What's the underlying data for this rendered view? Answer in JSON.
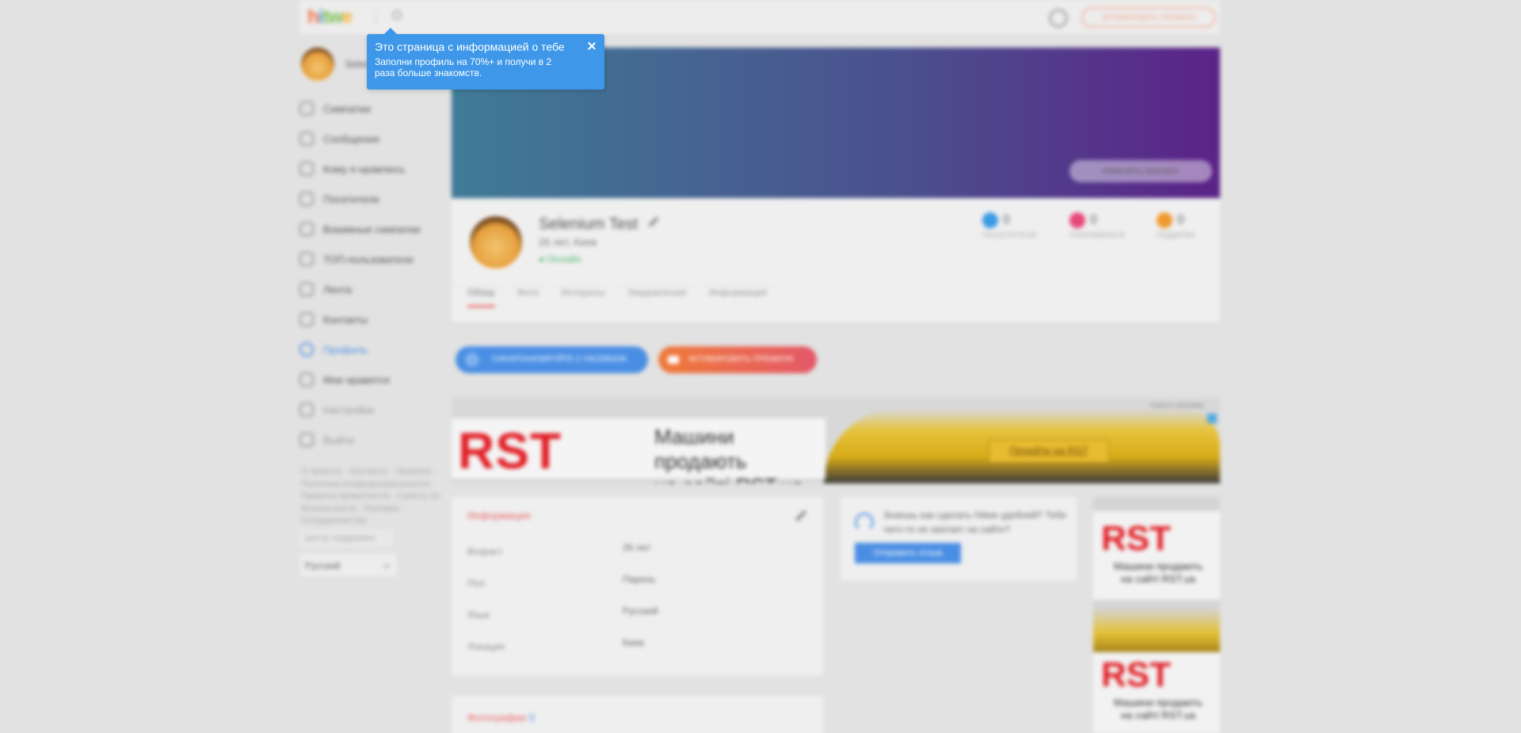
{
  "topbar": {
    "logo": {
      "h": "h",
      "i": "i",
      "t": "tw",
      "e": "oo"
    },
    "premium_label": "АКТИВИРОВАТЬ ПРЕМИУМ"
  },
  "sidebar": {
    "user_name": "Selenium",
    "items": [
      {
        "label": "Симпатии"
      },
      {
        "label": "Сообщения"
      },
      {
        "label": "Кому я нравлюсь"
      },
      {
        "label": "Посетители"
      },
      {
        "label": "Взаимные симпатии"
      },
      {
        "label": "ТОП-пользователи"
      },
      {
        "label": "Лента"
      },
      {
        "label": "Контакты"
      },
      {
        "label": "Профиль"
      },
      {
        "label": "Мне нравятся"
      },
      {
        "label": "Настройки"
      },
      {
        "label": "Выйти"
      }
    ],
    "footer_links": "О проекте · Контакты · Правила · Политика конфиденциальности · Правила приватности · Советы по безопасности · Реклама · Сотрудничество",
    "support_label": "Центр поддержки",
    "language": "Русский"
  },
  "profile": {
    "change_cover_label": "ИЗМЕНИТЬ ОБЛОЖКУ",
    "name": "Selenium Test",
    "meta": "26 лет, Киев",
    "online": "● Онлайн",
    "stats": [
      {
        "value": "0",
        "label": "ПОСЕТИТЕЛИ",
        "color": "#3a9be6"
      },
      {
        "value": "0",
        "label": "ПОНРАВИЛСЯ",
        "color": "#e8477a"
      },
      {
        "value": "0",
        "label": "ПОДАРКИ",
        "color": "#ef9a2e"
      }
    ],
    "tabs": [
      "Обзор",
      "Фото",
      "Интересы",
      "Уведомления",
      "Информация"
    ]
  },
  "actions": {
    "sync_label": "СИНХРОНИЗИРУЙТЕ С FACEBOOK",
    "premium_label": "АКТИВИРОВАТЬ ПРЕМИУМ"
  },
  "ad": {
    "logo": "RST",
    "line1": "Машини продають",
    "line2_prefix": "на сайті ",
    "line2_link": "RST.ua",
    "cta": "Перейти на RST",
    "label": "Скрыть рекламу"
  },
  "info": {
    "title": "Информация",
    "rows": [
      {
        "label": "Возраст",
        "value": "26 лет"
      },
      {
        "label": "Пол",
        "value": "Парень"
      },
      {
        "label": "Язык",
        "value": "Русский"
      },
      {
        "label": "Локация",
        "value": "Киев"
      }
    ]
  },
  "feedback": {
    "text": "Знаешь как сделать Hitwe удобней? Тебе чего-то не хватает на сайте?",
    "button": "Отправить отзыв"
  },
  "side_ad": {
    "logo": "RST",
    "line1": "Машини продають",
    "line2": "на сайті RST.ua"
  },
  "photos": {
    "title": "Фотографии",
    "count": "0"
  },
  "tooltip": {
    "title": "Это страница с информацией о тебе",
    "body": "Заполни профиль на 70%+ и получи в 2 раза больше знакомств."
  }
}
